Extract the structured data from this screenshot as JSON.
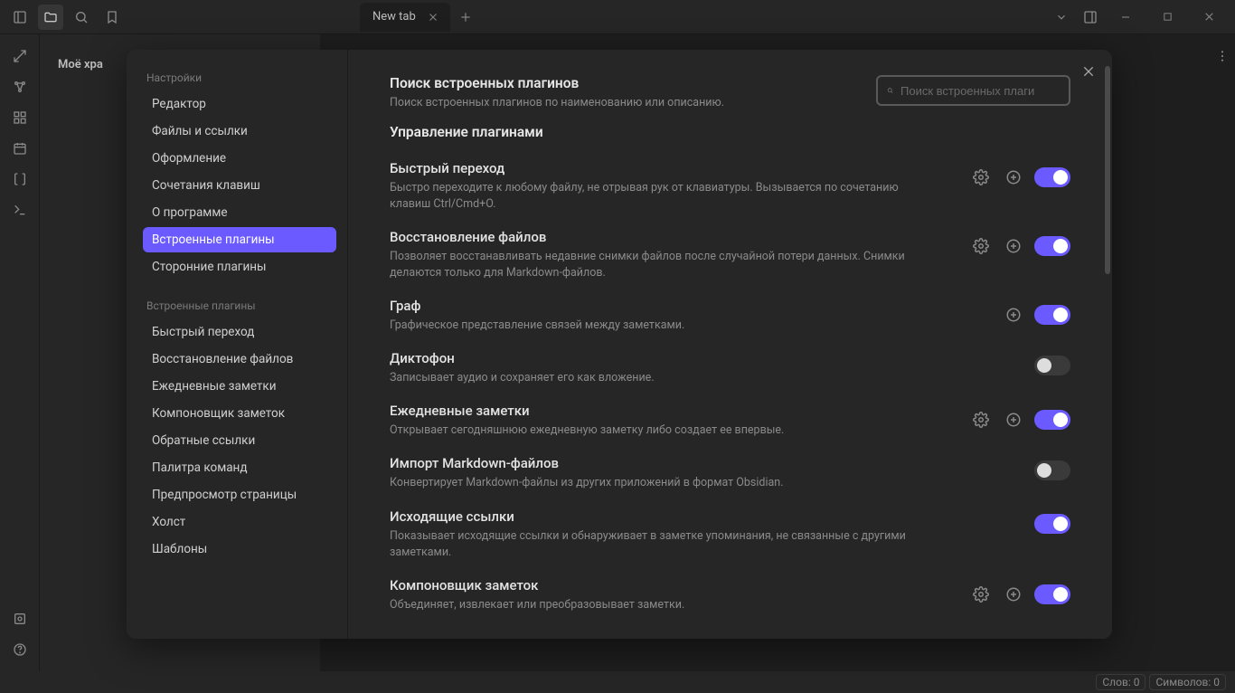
{
  "titlebar": {
    "tab_label": "New tab"
  },
  "vault": {
    "title": "Моё хра"
  },
  "main": {
    "tab_title": "New tab"
  },
  "status": {
    "words": "Слов: 0",
    "chars": "Символов: 0"
  },
  "settings": {
    "section1_title": "Настройки",
    "nav1": [
      "Редактор",
      "Файлы и ссылки",
      "Оформление",
      "Сочетания клавиш",
      "О программе",
      "Встроенные плагины",
      "Сторонние плагины"
    ],
    "nav1_active": 5,
    "section2_title": "Встроенные плагины",
    "nav2": [
      "Быстрый переход",
      "Восстановление файлов",
      "Ежедневные заметки",
      "Компоновщик заметок",
      "Обратные ссылки",
      "Палитра команд",
      "Предпросмотр страницы",
      "Холст",
      "Шаблоны"
    ],
    "search_title": "Поиск встроенных плагинов",
    "search_desc": "Поиск встроенных плагинов по наименованию или описанию.",
    "search_placeholder": "Поиск встроенных плаги",
    "manage_heading": "Управление плагинами",
    "plugins": [
      {
        "name": "Быстрый переход",
        "desc": "Быстро переходите к любому файлу, не отрывая рук от клавиатуры. Вызывается по сочетанию клавиш Ctrl/Cmd+O.",
        "gear": true,
        "plus": true,
        "on": true
      },
      {
        "name": "Восстановление файлов",
        "desc": "Позволяет восстанавливать недавние снимки файлов после случайной потери данных. Снимки делаются только для Markdown-файлов.",
        "gear": true,
        "plus": true,
        "on": true
      },
      {
        "name": "Граф",
        "desc": "Графическое представление связей между заметками.",
        "gear": false,
        "plus": true,
        "on": true
      },
      {
        "name": "Диктофон",
        "desc": "Записывает аудио и сохраняет его как вложение.",
        "gear": false,
        "plus": false,
        "on": false
      },
      {
        "name": "Ежедневные заметки",
        "desc": "Открывает сегодняшнюю ежедневную заметку либо создает ее впервые.",
        "gear": true,
        "plus": true,
        "on": true
      },
      {
        "name": "Импорт Markdown-файлов",
        "desc": "Конвертирует Markdown-файлы из других приложений в формат Obsidian.",
        "gear": false,
        "plus": false,
        "on": false
      },
      {
        "name": "Исходящие ссылки",
        "desc": "Показывает исходящие ссылки и обнаруживает в заметке упоминания, не связанные с другими заметками.",
        "gear": false,
        "plus": false,
        "on": true
      },
      {
        "name": "Компоновщик заметок",
        "desc": "Объединяет, извлекает или преобразовывает заметки.",
        "gear": true,
        "plus": true,
        "on": true
      }
    ]
  }
}
